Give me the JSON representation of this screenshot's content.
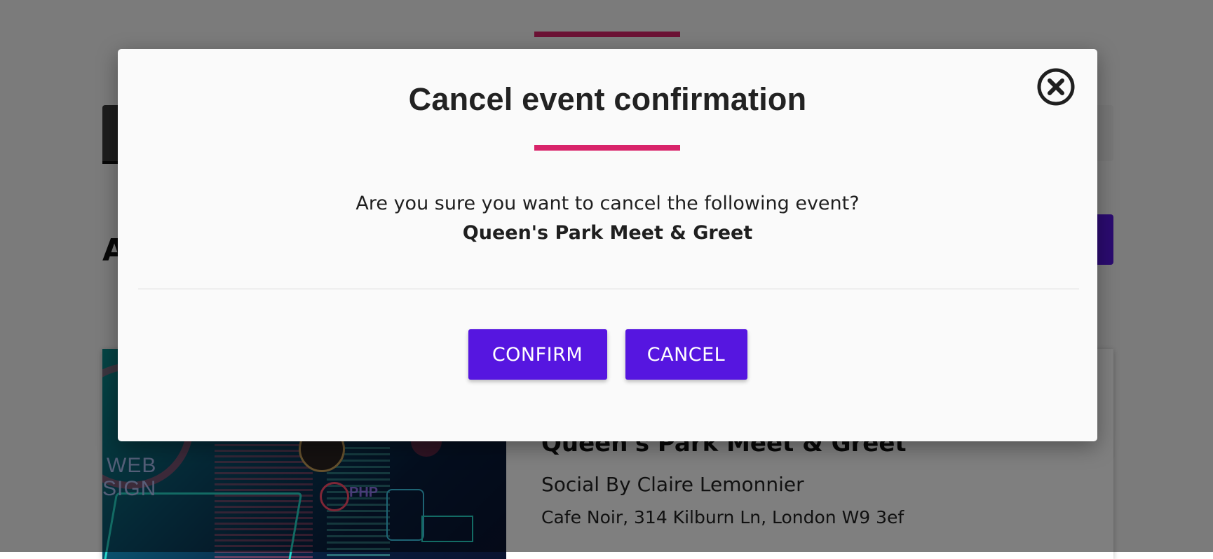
{
  "background": {
    "heading_fragment": "A",
    "event_card": {
      "title": "Queen's Park Meet & Greet",
      "organiser": "Social By Claire Lemonnier",
      "address": "Cafe Noir, 314 Kilburn Ln, London W9 3ef",
      "image_text": {
        "web": "WEB",
        "sign": "SIGN",
        "php": "PHP"
      }
    }
  },
  "modal": {
    "title": "Cancel event confirmation",
    "question": "Are you sure you want to cancel the following event?",
    "event_name": "Queen's Park Meet & Greet",
    "close_icon": "close-circle-icon",
    "confirm_label": "CONFIRM",
    "cancel_label": "CANCEL"
  },
  "colors": {
    "accent_pink": "#d8246a",
    "primary_purple": "#5616e0",
    "overlay": "rgba(0,0,0,0.5)"
  }
}
